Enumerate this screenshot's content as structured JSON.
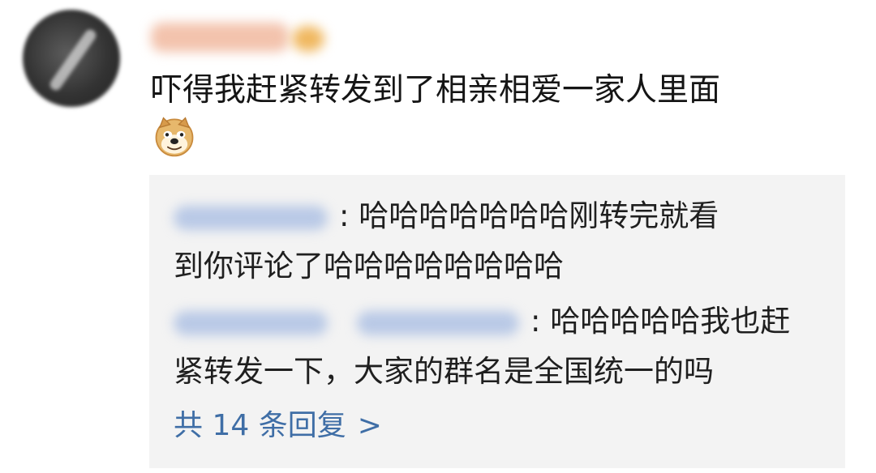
{
  "post": {
    "comment_text": "吓得我赶紧转发到了相亲相爱一家人里面",
    "emoji": "doge-emoji"
  },
  "replies": [
    {
      "separator": ":",
      "text_line1": "哈哈哈哈哈哈哈刚转完就看",
      "text_line2": "到你评论了哈哈哈哈哈哈哈哈"
    },
    {
      "separator": ":",
      "text_line1": "哈哈哈哈哈我也赶",
      "text_line2": "紧转发一下，大家的群名是全国统一的吗"
    }
  ],
  "more_replies": {
    "label": "共 14 条回复",
    "icon": "chevron-right-icon",
    "arrow": ">"
  },
  "colors": {
    "background": "#ffffff",
    "reply_box": "#f3f3f3",
    "text": "#151515",
    "link": "#3f6ea6"
  }
}
